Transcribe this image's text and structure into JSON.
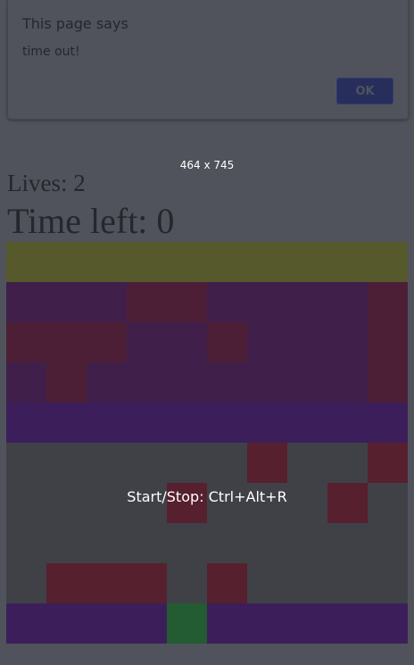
{
  "dialog": {
    "title": "This page says",
    "message": "time out!",
    "ok_label": "OK"
  },
  "viewport_label": "464 x 745",
  "hud": {
    "lives": "Lives: 2",
    "time_left": "Time left: 0"
  },
  "hint": "Start/Stop: Ctrl+Alt+R",
  "colors": {
    "background": "#50535b",
    "road": "#3f4147",
    "goal_row": "#55592c",
    "purple_lane": "#401f4a",
    "maroon": "#4d1f36",
    "safe_lane": "#3c1f5a",
    "car": "#56202f",
    "player": "#235b32",
    "ok_button": "#272e5c"
  },
  "board": {
    "columns": 10,
    "rows": 10,
    "legend": {
      "G": "goal",
      "P": "purple-tile",
      "M": "maroon-tile",
      "V": "safe-lane",
      "R": "road",
      "C": "car",
      "F": "player-frog"
    },
    "cells": [
      "GGGGGGGGGG",
      "PPPMMPPPPM",
      "MMMPPMPPPM",
      "PMPPPPPPPM",
      "VVVVVVVVVV",
      "RRRRRRCRRC",
      "RRRRCRRRCR",
      "RRRRRRRRRR",
      "RCCCRCRRRR",
      "VVVVFVVVVV"
    ]
  }
}
